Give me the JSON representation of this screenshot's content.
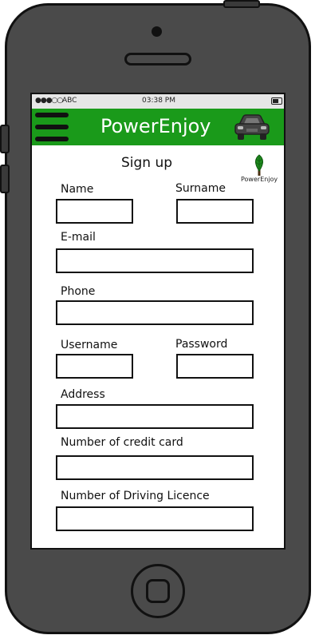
{
  "status_bar": {
    "signal": "●●●○○",
    "carrier": "ABC",
    "time": "03:38 PM"
  },
  "app_bar": {
    "title": "PowerEnjoy"
  },
  "page": {
    "title": "Sign up",
    "logo_text": "PowerEnjoy"
  },
  "form": {
    "name_label": "Name",
    "surname_label": "Surname",
    "email_label": "E-mail",
    "phone_label": "Phone",
    "username_label": "Username",
    "password_label": "Password",
    "address_label": "Address",
    "credit_card_label": "Number of credit card",
    "driving_licence_label": "Number of Driving Licence"
  },
  "colors": {
    "app_bar": "#1a9a1a",
    "phone_body": "#4a4a4a"
  },
  "icons": {
    "menu": "hamburger-icon",
    "car": "car-icon",
    "logo": "leaf-logo"
  }
}
